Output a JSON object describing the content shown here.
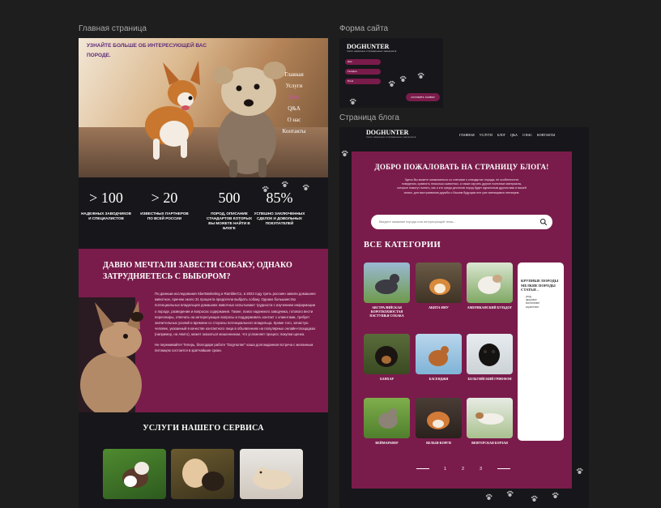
{
  "frames": {
    "main_label": "Главная страница",
    "form_label": "Форма сайта",
    "blog_label": "Страница блога"
  },
  "main": {
    "hero_title": "УЗНАЙТЕ БОЛЬШЕ ОБ ИНТЕРЕСУЮЩЕЙ ВАС ПОРОДЕ.",
    "nav": [
      "Главная",
      "Услуги",
      "Блог",
      "Q&A",
      "О нас",
      "Контакты"
    ],
    "stats": [
      {
        "num": "> 100",
        "caption": "НАДЕЖНЫХ ЗАВОДЧИКОВ И СПЕЦИАЛИСТОВ"
      },
      {
        "num": "> 20",
        "caption": "ИЗВЕСТНЫХ ПАРТНЕРОВ ПО ВСЕЙ РОССИИ"
      },
      {
        "num": "500",
        "caption": "ПОРОД, ОПИСАНИЕ СТАНДАРТОВ КОТОРЫХ ВЫ МОЖЕТЕ НАЙТИ В БЛОГЕ"
      },
      {
        "num": "85%",
        "caption": "УСПЕШНО ЗАКЛЮЧЕННЫХ СДЕЛОК И ДОВОЛЬНЫХ ПОКУПАТЕЛЕЙ"
      }
    ],
    "dream_title": "ДАВНО МЕЧТАЛИ ЗАВЕСТИ СОБАКУ, ОДНАКО ЗАТРУДНЯЕТЕСЬ С ВЫБОРОМ?",
    "dream_p1": "По данным исследования SberMarketing и RamblerCo, в 2023 году треть россиян завели домашнее животное, причем около 31 процента предпочли выбрать собаку. Однако большинство потенциальных владельцев домашних животных испытывают трудности с изучением информации о породе, разведении и вопросах содержания. Также, поиск надежного заводчика, готового вести переговоры, отвечать на интересующие вопросы и поддерживать контакт с клиентами, требует значительных усилий и времени со стороны потенциального владельца. Кроме того, зачастую человек, указанный в качестве контактного лица в объявлениях на популярных онлайн-площадках (например, на Авито), может оказаться мошенником, что усложняет процесс покупки щенка.",
    "dream_p2": "Не переживайте! Теперь, благодаря работе \"DogHunter\" каша долгожданная встреча с желанным питомцем состоится в кратчайшие сроки.",
    "services_title": "УСЛУГИ НАШЕГО СЕРВИСА"
  },
  "form": {
    "logo": "DOGHUNTER",
    "sub": "поиск надежных и проверенных заводчиков",
    "fields": [
      "Имя",
      "Телефон",
      "Email"
    ],
    "button": "ОСТАВИТЬ ЗАЯВКУ"
  },
  "blog": {
    "logo": "DOGHUNTER",
    "sub": "поиск надежных и проверенных заводчиков",
    "nav": [
      "ГЛАВНАЯ",
      "УСЛУГИ",
      "БЛОГ",
      "Q&A",
      "О НАС",
      "КОНТАКТЫ"
    ],
    "title": "ДОБРО ПОЖАЛОВАТЬ НА СТРАНИЦУ БЛОГА!",
    "desc": "Здесь Вы можете ознакомиться со статьями о стандартах породы, ее особенностях поведения, сравнить несколько животных, а также изучить другие полезные материалы, которые помогут понять, как и кто среди десятков пород будет идеальным другом вам и вашей семье, для выстраивания дружбы с Вашим будущим или уже имеющимся питомцем.",
    "search_placeholder": "Введите название породы или интересующей темы...",
    "categories_title": "ВСЕ КАТЕГОРИИ",
    "breeds": [
      "АВСТРАЛИЙСКАЯ КОРОТКОХВОСТАЯ ПАСТУШЬЯ СОБАКА",
      "АКИТА-ИНУ",
      "АМЕРИКАНСКИЙ БУЛЬДОГ",
      "БАНХАР",
      "БАСЕНДЖИ",
      "БЕЛЬГИЙСКИЙ ГРИФФОН",
      "ВЕЙМАРАНЕР",
      "ВЕЛЬШ-КОРГИ",
      "ВЕНГЕРСКАЯ БОРЗАЯ"
    ],
    "side_title": "КРУПНЫЕ ПОРОДЫ МЕЛКИЕ ПОРОДЫ СТАТЬИ –",
    "side_items": [
      "уход",
      "здоровье",
      "воспитание",
      "кормление"
    ],
    "pages": [
      "1",
      "2",
      "3"
    ]
  },
  "colors": {
    "accent": "#7a1c4b",
    "bg": "#17161a",
    "nav_active": "#e13ce2"
  }
}
